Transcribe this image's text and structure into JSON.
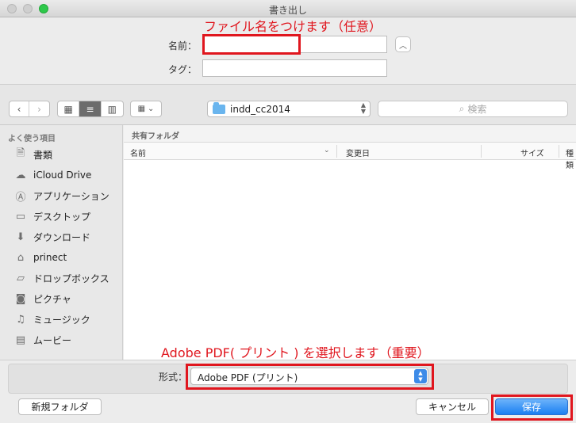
{
  "window": {
    "title": "書き出し"
  },
  "annotations": {
    "name_note": "ファイル名をつけます（任意）",
    "format_note": "Adobe PDF( プリント ) を選択します（重要）",
    "color": "#e0161e"
  },
  "form": {
    "name_label": "名前：",
    "name_value": "",
    "tag_label": "タグ：",
    "tag_value": "",
    "expand_icon": "chevron-up-icon"
  },
  "toolbar": {
    "back_icon": "‹",
    "forward_icon": "›",
    "view_modes": [
      "icon-view",
      "list-view",
      "column-view"
    ],
    "active_view": "list-view",
    "location": "indd_cc2014",
    "search_placeholder": "検索"
  },
  "sidebar": {
    "heading": "よく使う項目",
    "items": [
      {
        "label": "書類",
        "icon": "document-icon",
        "glyph": "🗎"
      },
      {
        "label": "iCloud Drive",
        "icon": "cloud-icon",
        "glyph": "☁"
      },
      {
        "label": "アプリケーション",
        "icon": "applications-icon",
        "glyph": "Ⓐ"
      },
      {
        "label": "デスクトップ",
        "icon": "desktop-icon",
        "glyph": "▭"
      },
      {
        "label": "ダウンロード",
        "icon": "download-icon",
        "glyph": "⬇"
      },
      {
        "label": "prinect",
        "icon": "home-icon",
        "glyph": "⌂"
      },
      {
        "label": "ドロップボックス",
        "icon": "folder-icon",
        "glyph": "▱"
      },
      {
        "label": "ピクチャ",
        "icon": "camera-icon",
        "glyph": "◙"
      },
      {
        "label": "ミュージック",
        "icon": "music-icon",
        "glyph": "♫"
      },
      {
        "label": "ムービー",
        "icon": "film-icon",
        "glyph": "▤"
      }
    ]
  },
  "content": {
    "path": "共有フォルダ",
    "columns": {
      "name": "名前",
      "date": "変更日",
      "size": "サイズ",
      "kind": "種類"
    }
  },
  "footer": {
    "format_label": "形式：",
    "format_value": "Adobe PDF (プリント)",
    "new_folder_label": "新規フォルダ",
    "cancel_label": "キャンセル",
    "save_label": "保存"
  }
}
